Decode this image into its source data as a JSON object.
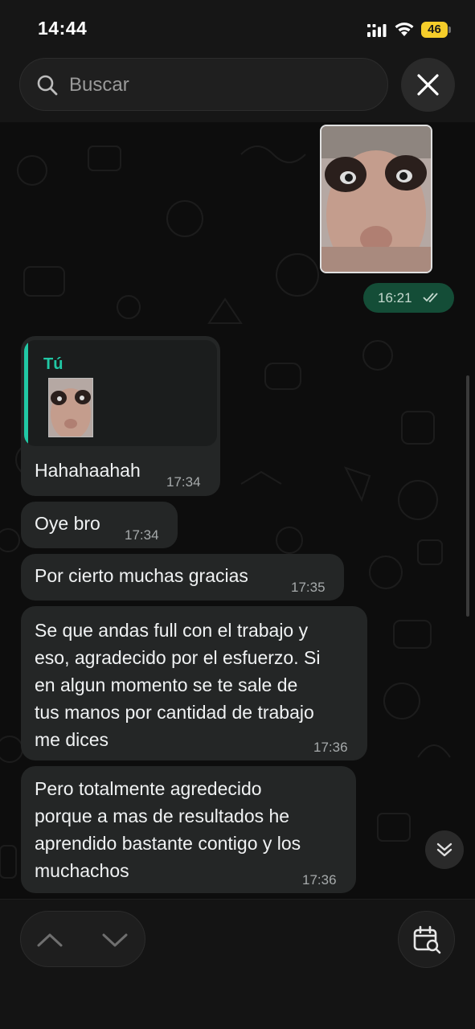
{
  "status_bar": {
    "time": "14:44",
    "battery_level": "46",
    "icons": [
      "cellular-signal-icon",
      "wifi-icon",
      "battery-icon"
    ]
  },
  "search": {
    "placeholder": "Buscar",
    "icon": "search-icon",
    "close_icon": "close-icon"
  },
  "messages": [
    {
      "type": "image",
      "direction": "sent",
      "time": "16:21",
      "status": "read",
      "status_icon": "double-check-icon"
    },
    {
      "type": "reply",
      "direction": "received",
      "quoted_sender": "Tú",
      "quoted_content": "image",
      "text": "Hahahaahah",
      "time": "17:34"
    },
    {
      "type": "text",
      "direction": "received",
      "text": "Oye bro",
      "time": "17:34"
    },
    {
      "type": "text",
      "direction": "received",
      "text": "Por cierto muchas gracias",
      "time": "17:35"
    },
    {
      "type": "text",
      "direction": "received",
      "lines": [
        "Se que andas full con el trabajo y",
        "eso, agradecido por el esfuerzo. Si",
        "en algun momento se te sale de",
        "tus manos por cantidad de trabajo",
        "me dices"
      ],
      "time": "17:36"
    },
    {
      "type": "text",
      "direction": "received",
      "lines": [
        "Pero totalmente agredecido",
        "porque a mas de resultados he",
        "aprendido bastante contigo y los",
        "muchachos"
      ],
      "time": "17:36"
    }
  ],
  "bottom_bar": {
    "icons": [
      "chevron-up-icon",
      "chevron-down-icon",
      "calendar-search-icon"
    ]
  },
  "colors": {
    "background": "#0d0d0d",
    "bubble_received": "#242626",
    "bubble_sent": "#144d37",
    "accent": "#21c8a5",
    "battery": "#f5cd2a"
  }
}
